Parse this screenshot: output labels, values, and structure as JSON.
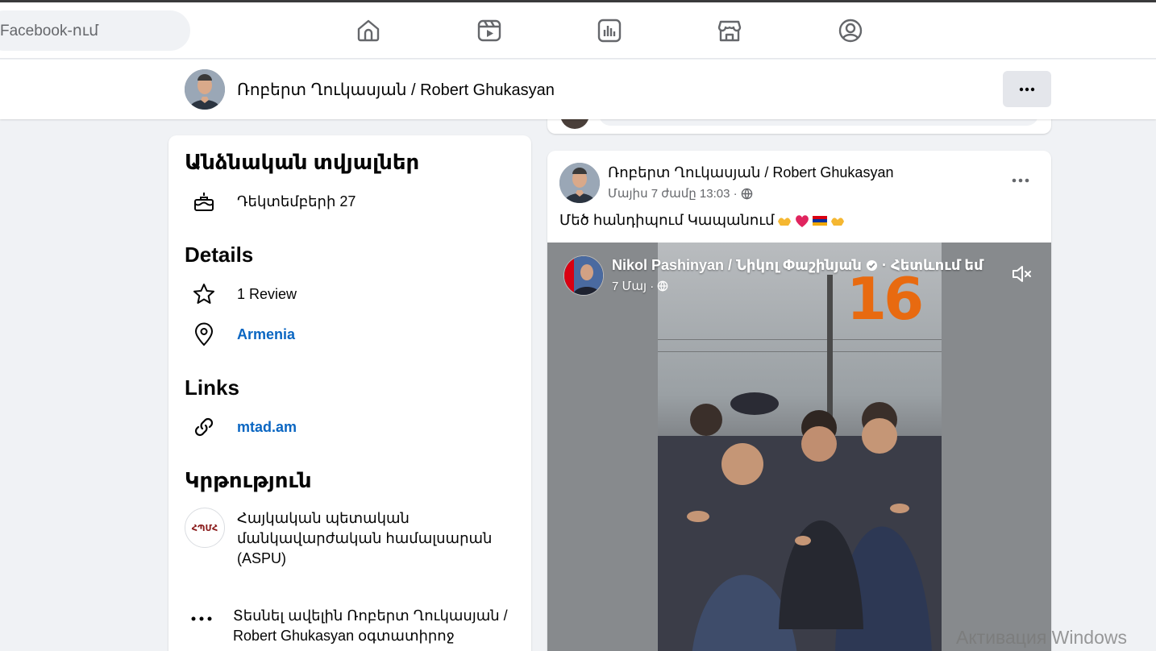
{
  "topbar": {
    "search_value": "Facebook-ում",
    "nav_icons": [
      "home-icon",
      "reels-icon",
      "dashboard-icon",
      "marketplace-icon",
      "profile-icon"
    ]
  },
  "profile_bar": {
    "name": "Ռոբերտ Ղուկասյան / Robert Ghukasyan",
    "more_icon": "more-horizontal-icon"
  },
  "intro": {
    "personal_title": "Անձնական տվյալներ",
    "birthday": "Դեկտեմբերի 27",
    "details_title": "Details",
    "review": "1 Review",
    "location": "Armenia",
    "links_title": "Links",
    "website": "mtad.am",
    "education_title": "Կրթություն",
    "school_logo_text": "ՀՊՄՀ",
    "school": "Հայկական պետական մանկավարժական համալսարան (ASPU)",
    "see_more": "Տեսնել ավելին Ռոբերտ Ղուկասյան / Robert Ghukasyan օգտատիրոջ"
  },
  "post": {
    "author": "Ռոբերտ Ղուկասյան / Robert Ghukasyan",
    "date": "Մայիս 7 ժամը 13:03 ·",
    "privacy_icon": "globe-icon",
    "text": "Մեծ հանդիպում Կապանում"
  },
  "video": {
    "author": "Nikol Pashinyan / Նիկոլ Փաշինյան",
    "follow_text": "· Հետևում եմ",
    "date": "7 Մայ ·",
    "overlay_number": "16",
    "verified_icon": "verified-badge-icon",
    "mute_icon": "muted-speaker-icon"
  },
  "watermark": "Активация Windows",
  "colors": {
    "link": "#0a66c2",
    "background": "#f0f2f5",
    "card": "#ffffff",
    "accent_orange": "#e86a10"
  }
}
